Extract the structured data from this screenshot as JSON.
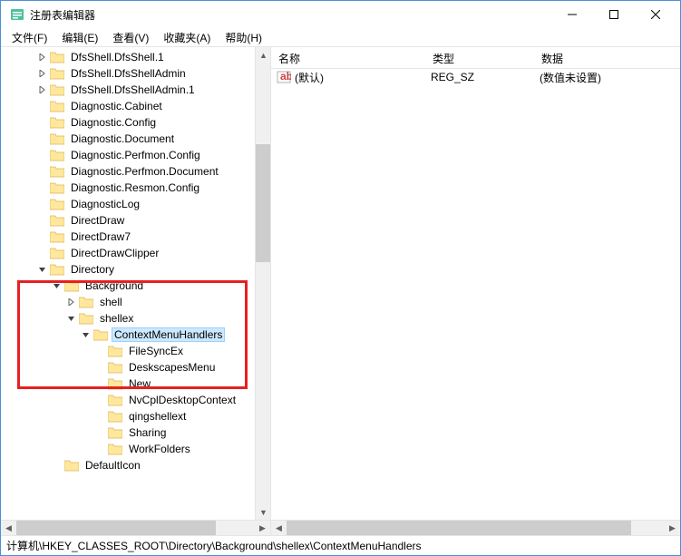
{
  "window": {
    "title": "注册表编辑器"
  },
  "menu": {
    "file": "文件(F)",
    "edit": "编辑(E)",
    "view": "查看(V)",
    "favorites": "收藏夹(A)",
    "help": "帮助(H)"
  },
  "tree": [
    {
      "indent": 40,
      "exp": "right",
      "label": "DfsShell.DfsShell.1"
    },
    {
      "indent": 40,
      "exp": "right",
      "label": "DfsShell.DfsShellAdmin"
    },
    {
      "indent": 40,
      "exp": "right",
      "label": "DfsShell.DfsShellAdmin.1"
    },
    {
      "indent": 40,
      "exp": "",
      "label": "Diagnostic.Cabinet"
    },
    {
      "indent": 40,
      "exp": "",
      "label": "Diagnostic.Config"
    },
    {
      "indent": 40,
      "exp": "",
      "label": "Diagnostic.Document"
    },
    {
      "indent": 40,
      "exp": "",
      "label": "Diagnostic.Perfmon.Config"
    },
    {
      "indent": 40,
      "exp": "",
      "label": "Diagnostic.Perfmon.Document"
    },
    {
      "indent": 40,
      "exp": "",
      "label": "Diagnostic.Resmon.Config"
    },
    {
      "indent": 40,
      "exp": "",
      "label": "DiagnosticLog"
    },
    {
      "indent": 40,
      "exp": "",
      "label": "DirectDraw"
    },
    {
      "indent": 40,
      "exp": "",
      "label": "DirectDraw7"
    },
    {
      "indent": 40,
      "exp": "",
      "label": "DirectDrawClipper"
    },
    {
      "indent": 40,
      "exp": "down",
      "label": "Directory"
    },
    {
      "indent": 56,
      "exp": "down",
      "label": "Background"
    },
    {
      "indent": 72,
      "exp": "right",
      "label": "shell"
    },
    {
      "indent": 72,
      "exp": "down",
      "label": "shellex"
    },
    {
      "indent": 88,
      "exp": "down",
      "label": "ContextMenuHandlers",
      "selected": true
    },
    {
      "indent": 104,
      "exp": "",
      "label": "FileSyncEx"
    },
    {
      "indent": 104,
      "exp": "",
      "label": "DeskscapesMenu"
    },
    {
      "indent": 104,
      "exp": "",
      "label": "New"
    },
    {
      "indent": 104,
      "exp": "",
      "label": "NvCplDesktopContext"
    },
    {
      "indent": 104,
      "exp": "",
      "label": "qingshellext"
    },
    {
      "indent": 104,
      "exp": "",
      "label": "Sharing"
    },
    {
      "indent": 104,
      "exp": "",
      "label": "WorkFolders"
    },
    {
      "indent": 56,
      "exp": "",
      "label": "DefaultIcon"
    }
  ],
  "list": {
    "columns": {
      "name": "名称",
      "type": "类型",
      "data": "数据"
    },
    "rows": [
      {
        "name": "(默认)",
        "type": "REG_SZ",
        "data": "(数值未设置)"
      }
    ]
  },
  "statusbar": {
    "path": "计算机\\HKEY_CLASSES_ROOT\\Directory\\Background\\shellex\\ContextMenuHandlers"
  }
}
